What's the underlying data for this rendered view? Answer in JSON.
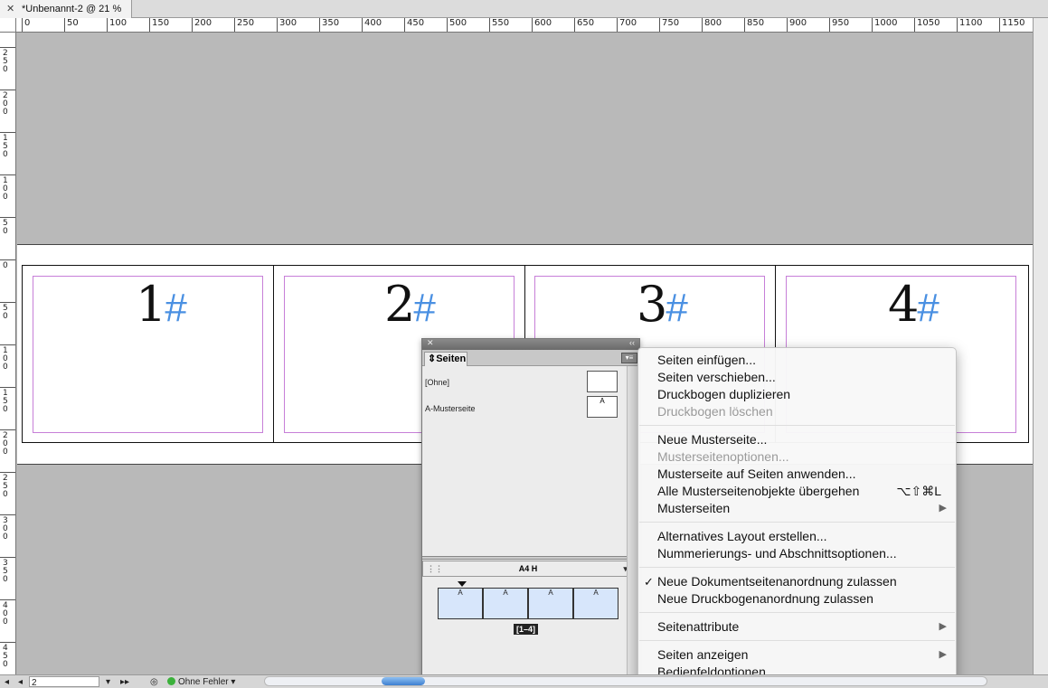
{
  "document_tab": {
    "close": "✕",
    "title": "*Unbenannt-2 @ 21 %"
  },
  "ruler": {
    "horizontal": [
      "0",
      "50",
      "100",
      "150",
      "200",
      "250",
      "300",
      "350",
      "400",
      "450",
      "500",
      "550",
      "600",
      "650",
      "700",
      "750",
      "800",
      "850",
      "900",
      "950",
      "1000",
      "1050",
      "1100",
      "1150"
    ],
    "vertical": [
      "250",
      "200",
      "150",
      "100",
      "50",
      "0",
      "50",
      "100",
      "150",
      "200",
      "250",
      "300",
      "350",
      "400",
      "450"
    ]
  },
  "pages": [
    {
      "number": "1",
      "marker": "#"
    },
    {
      "number": "2",
      "marker": "#"
    },
    {
      "number": "3",
      "marker": "#"
    },
    {
      "number": "4",
      "marker": "#"
    }
  ],
  "pages_panel": {
    "close": "✕",
    "collapse": "‹‹",
    "tab_label": "Seiten",
    "menu_button": "▾≡",
    "masters": [
      {
        "name": "[Ohne]",
        "thumb": ""
      },
      {
        "name": "A-Musterseite",
        "thumb": "A"
      }
    ],
    "size_label": "A4 H",
    "spread_label": "[1–4]",
    "page_thumb_labels": [
      "A",
      "A",
      "A",
      "A"
    ]
  },
  "context_menu": {
    "groups": [
      [
        {
          "label": "Seiten einfügen...",
          "enabled": true
        },
        {
          "label": "Seiten verschieben...",
          "enabled": true
        },
        {
          "label": "Druckbogen duplizieren",
          "enabled": true
        },
        {
          "label": "Druckbogen löschen",
          "enabled": false
        }
      ],
      [
        {
          "label": "Neue Musterseite...",
          "enabled": true
        },
        {
          "label": "Musterseitenoptionen...",
          "enabled": false
        },
        {
          "label": "Musterseite auf Seiten anwenden...",
          "enabled": true
        },
        {
          "label": "Alle Musterseitenobjekte übergehen",
          "enabled": true,
          "shortcut": "⌥⇧⌘L"
        },
        {
          "label": "Musterseiten",
          "enabled": true,
          "submenu": true
        }
      ],
      [
        {
          "label": "Alternatives Layout erstellen...",
          "enabled": true
        },
        {
          "label": "Nummerierungs- und Abschnittsoptionen...",
          "enabled": true
        }
      ],
      [
        {
          "label": "Neue Dokumentseitenanordnung zulassen",
          "enabled": true,
          "checked": true
        },
        {
          "label": "Neue Druckbogenanordnung zulassen",
          "enabled": true
        }
      ],
      [
        {
          "label": "Seitenattribute",
          "enabled": true,
          "submenu": true
        }
      ],
      [
        {
          "label": "Seiten anzeigen",
          "enabled": true,
          "submenu": true
        },
        {
          "label": "Bedienfeldoptionen...",
          "enabled": true
        }
      ]
    ]
  },
  "status_bar": {
    "page_field": "2",
    "nav_first": "◂",
    "nav_last": "▸▸",
    "preflight_status": "Ohne Fehler"
  },
  "colors": {
    "pasteboard": "#b9b9b9",
    "margin_guide": "#c77fd8",
    "section_marker": "#4a90e2",
    "thumb_fill": "#d7e6fb"
  }
}
